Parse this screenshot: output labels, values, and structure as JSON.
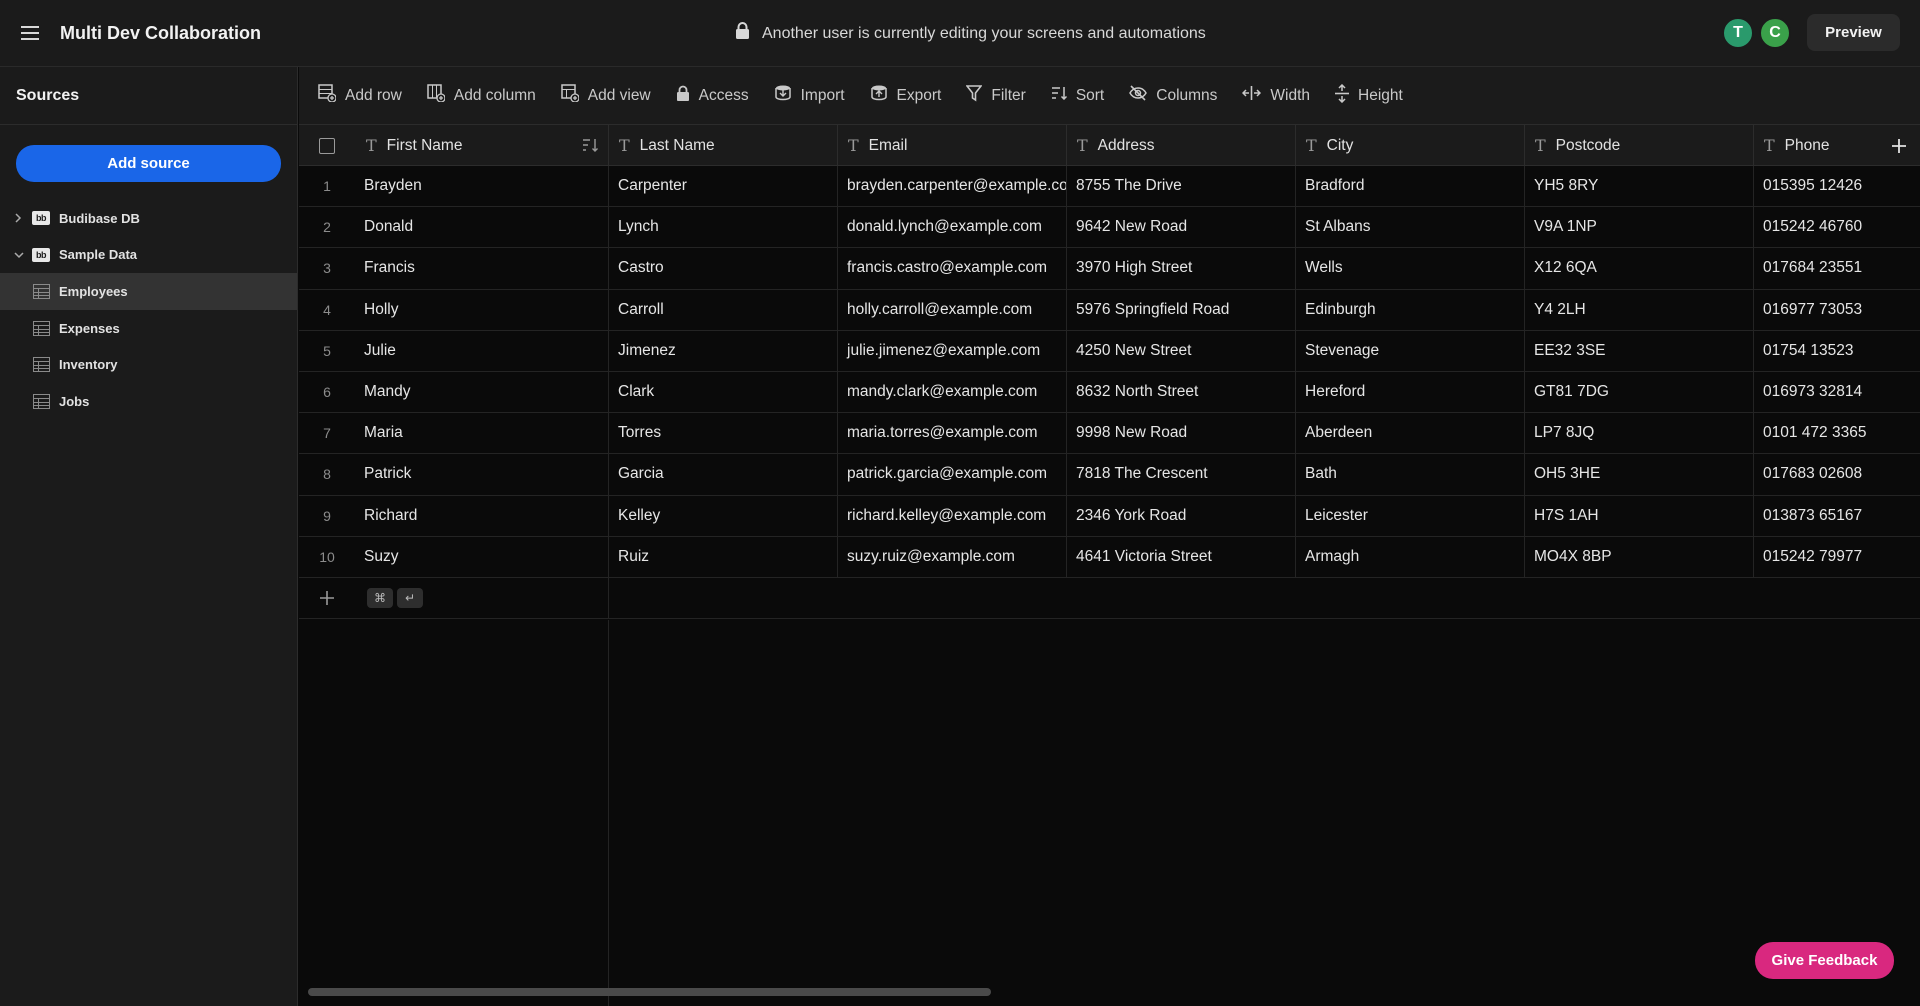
{
  "app": {
    "title": "Multi Dev Collaboration"
  },
  "notice": {
    "text": "Another user is currently editing your screens and automations"
  },
  "users": [
    {
      "initial": "T",
      "color": "#2a9a6c"
    },
    {
      "initial": "C",
      "color": "#3aa14a"
    }
  ],
  "header": {
    "preview_label": "Preview"
  },
  "sidebar": {
    "title": "Sources",
    "add_source_label": "Add source",
    "sources": [
      {
        "label": "Budibase DB",
        "expanded": false
      },
      {
        "label": "Sample Data",
        "expanded": true
      }
    ],
    "tables": [
      {
        "label": "Employees",
        "selected": true
      },
      {
        "label": "Expenses",
        "selected": false
      },
      {
        "label": "Inventory",
        "selected": false
      },
      {
        "label": "Jobs",
        "selected": false
      }
    ]
  },
  "toolbar": {
    "add_row": "Add row",
    "add_column": "Add column",
    "add_view": "Add view",
    "access": "Access",
    "import": "Import",
    "export": "Export",
    "filter": "Filter",
    "sort": "Sort",
    "columns": "Columns",
    "width": "Width",
    "height": "Height"
  },
  "grid": {
    "type_icon": "T",
    "columns": [
      "First Name",
      "Last Name",
      "Email",
      "Address",
      "City",
      "Postcode",
      "Phone"
    ],
    "rows": [
      {
        "n": "1",
        "first": "Brayden",
        "last": "Carpenter",
        "email": "brayden.carpenter@example.com",
        "address": "8755 The Drive",
        "city": "Bradford",
        "postcode": "YH5 8RY",
        "phone": "015395 12426"
      },
      {
        "n": "2",
        "first": "Donald",
        "last": "Lynch",
        "email": "donald.lynch@example.com",
        "address": "9642 New Road",
        "city": "St Albans",
        "postcode": "V9A 1NP",
        "phone": "015242 46760"
      },
      {
        "n": "3",
        "first": "Francis",
        "last": "Castro",
        "email": "francis.castro@example.com",
        "address": "3970 High Street",
        "city": "Wells",
        "postcode": "X12 6QA",
        "phone": "017684 23551"
      },
      {
        "n": "4",
        "first": "Holly",
        "last": "Carroll",
        "email": "holly.carroll@example.com",
        "address": "5976 Springfield Road",
        "city": "Edinburgh",
        "postcode": "Y4 2LH",
        "phone": "016977 73053"
      },
      {
        "n": "5",
        "first": "Julie",
        "last": "Jimenez",
        "email": "julie.jimenez@example.com",
        "address": "4250 New Street",
        "city": "Stevenage",
        "postcode": "EE32 3SE",
        "phone": "01754 13523"
      },
      {
        "n": "6",
        "first": "Mandy",
        "last": "Clark",
        "email": "mandy.clark@example.com",
        "address": "8632 North Street",
        "city": "Hereford",
        "postcode": "GT81 7DG",
        "phone": "016973 32814"
      },
      {
        "n": "7",
        "first": "Maria",
        "last": "Torres",
        "email": "maria.torres@example.com",
        "address": "9998 New Road",
        "city": "Aberdeen",
        "postcode": "LP7 8JQ",
        "phone": "0101 472 3365"
      },
      {
        "n": "8",
        "first": "Patrick",
        "last": "Garcia",
        "email": "patrick.garcia@example.com",
        "address": "7818 The Crescent",
        "city": "Bath",
        "postcode": "OH5 3HE",
        "phone": "017683 02608"
      },
      {
        "n": "9",
        "first": "Richard",
        "last": "Kelley",
        "email": "richard.kelley@example.com",
        "address": "2346 York Road",
        "city": "Leicester",
        "postcode": "H7S 1AH",
        "phone": "013873 65167"
      },
      {
        "n": "10",
        "first": "Suzy",
        "last": "Ruiz",
        "email": "suzy.ruiz@example.com",
        "address": "4641 Victoria Street",
        "city": "Armagh",
        "postcode": "MO4X 8BP",
        "phone": "015242 79977"
      }
    ],
    "new_row_keys": [
      "⌘",
      "↵"
    ]
  },
  "feedback": {
    "label": "Give Feedback"
  }
}
